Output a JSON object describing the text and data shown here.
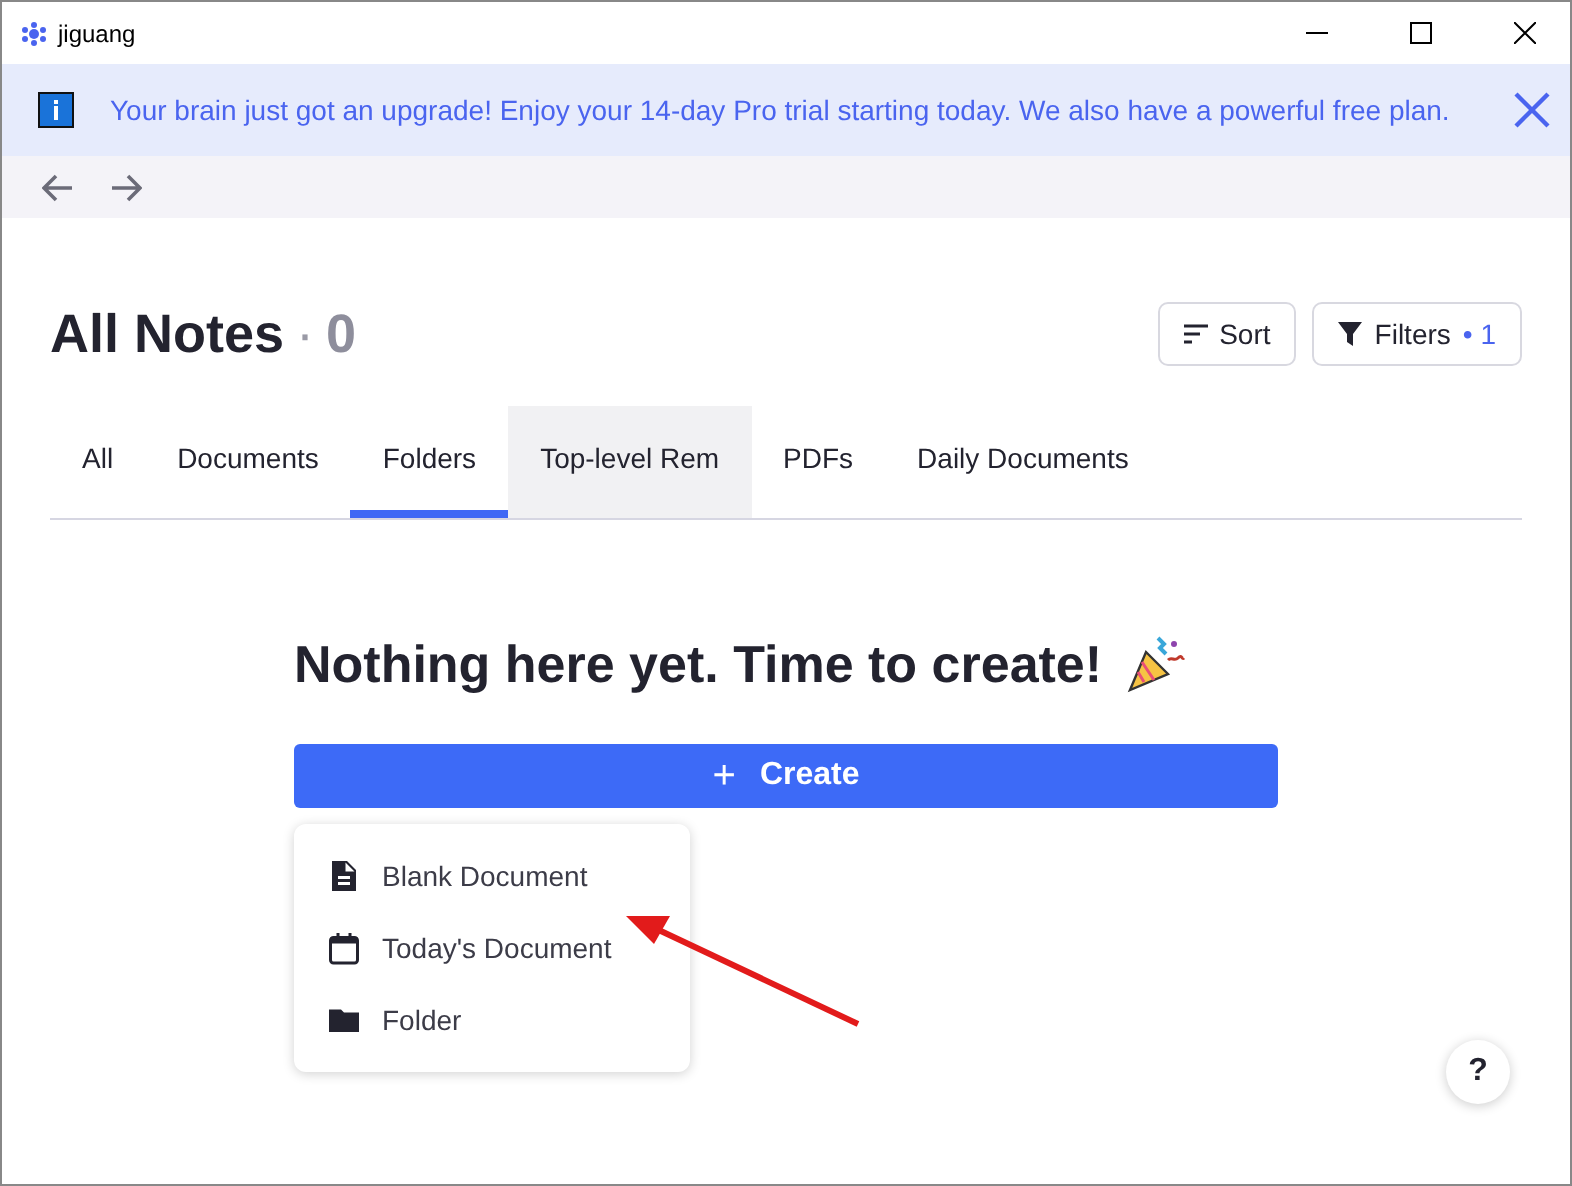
{
  "window": {
    "title": "jiguang"
  },
  "banner": {
    "text": "Your brain just got an upgrade! Enjoy your 14-day Pro trial starting today. We also have a powerful free plan."
  },
  "header": {
    "title": "All Notes",
    "separator": "·",
    "count": "0",
    "sort_label": "Sort",
    "filters_label": "Filters",
    "filters_separator": "•",
    "filters_count": "1"
  },
  "tabs": [
    {
      "label": "All",
      "selected": false,
      "hovered": false
    },
    {
      "label": "Documents",
      "selected": false,
      "hovered": false
    },
    {
      "label": "Folders",
      "selected": true,
      "hovered": false
    },
    {
      "label": "Top-level Rem",
      "selected": false,
      "hovered": true
    },
    {
      "label": "PDFs",
      "selected": false,
      "hovered": false
    },
    {
      "label": "Daily Documents",
      "selected": false,
      "hovered": false
    }
  ],
  "empty_state": {
    "heading": "Nothing here yet. Time to create!",
    "create_icon": "+",
    "create_label": "Create"
  },
  "create_menu": [
    {
      "kind": "document",
      "label": "Blank Document"
    },
    {
      "kind": "calendar",
      "label": "Today's Document"
    },
    {
      "kind": "folder",
      "label": "Folder"
    }
  ],
  "help_button": {
    "label": "?"
  }
}
